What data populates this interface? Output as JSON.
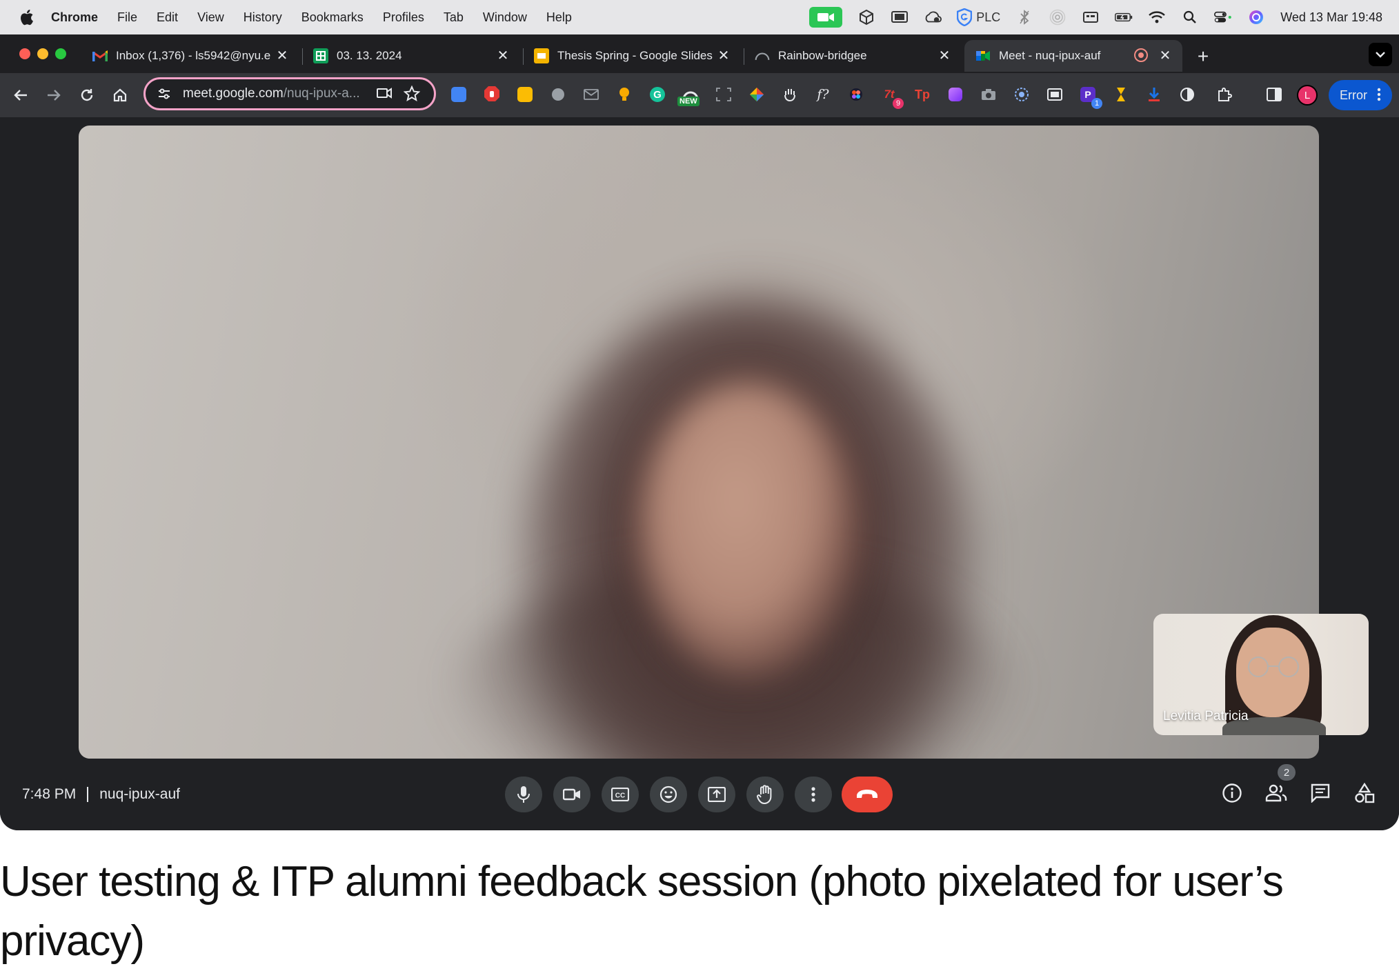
{
  "menubar": {
    "app": "Chrome",
    "items": [
      "File",
      "Edit",
      "View",
      "History",
      "Bookmarks",
      "Profiles",
      "Tab",
      "Window",
      "Help"
    ],
    "status_plc": "PLC",
    "datetime": "Wed 13 Mar  19:48",
    "status_icons": [
      "facetime-icon",
      "unity-icon",
      "display-icon",
      "cloud-icon",
      "grammarly-icon",
      "bluetooth-icon",
      "airdrop-icon",
      "keyboard-icon",
      "battery-icon",
      "wifi-icon",
      "search-icon",
      "control-center-icon",
      "siri-icon"
    ]
  },
  "tabs": [
    {
      "title": "Inbox (1,376) - ls5942@nyu.e",
      "icon": "gmail-icon"
    },
    {
      "title": "03. 13. 2024",
      "icon": "sheets-icon"
    },
    {
      "title": "Thesis Spring - Google Slides",
      "icon": "slides-icon"
    },
    {
      "title": "Rainbow-bridgee",
      "icon": "rainbow-icon"
    },
    {
      "title": "Meet - nuq-ipux-auf",
      "icon": "meet-icon",
      "active": true
    }
  ],
  "toolbar": {
    "url_host": "meet.google.com",
    "url_path": "/nuq-ipux-a...",
    "new_badge": "NEW",
    "badge_a": "9",
    "badge_b": "1",
    "avatar_letter": "L",
    "error_label": "Error"
  },
  "meet": {
    "time": "7:48 PM",
    "meeting_code": "nuq-ipux-auf",
    "self_name": "Levitia Patricia",
    "people_count": "2"
  },
  "caption": "User testing & ITP alumni feedback session (photo pixelated for user’s privacy)",
  "colors": {
    "end_call": "#ea4335",
    "omnibox_border": "#f5a3c8",
    "error_button": "#0b57d0"
  }
}
